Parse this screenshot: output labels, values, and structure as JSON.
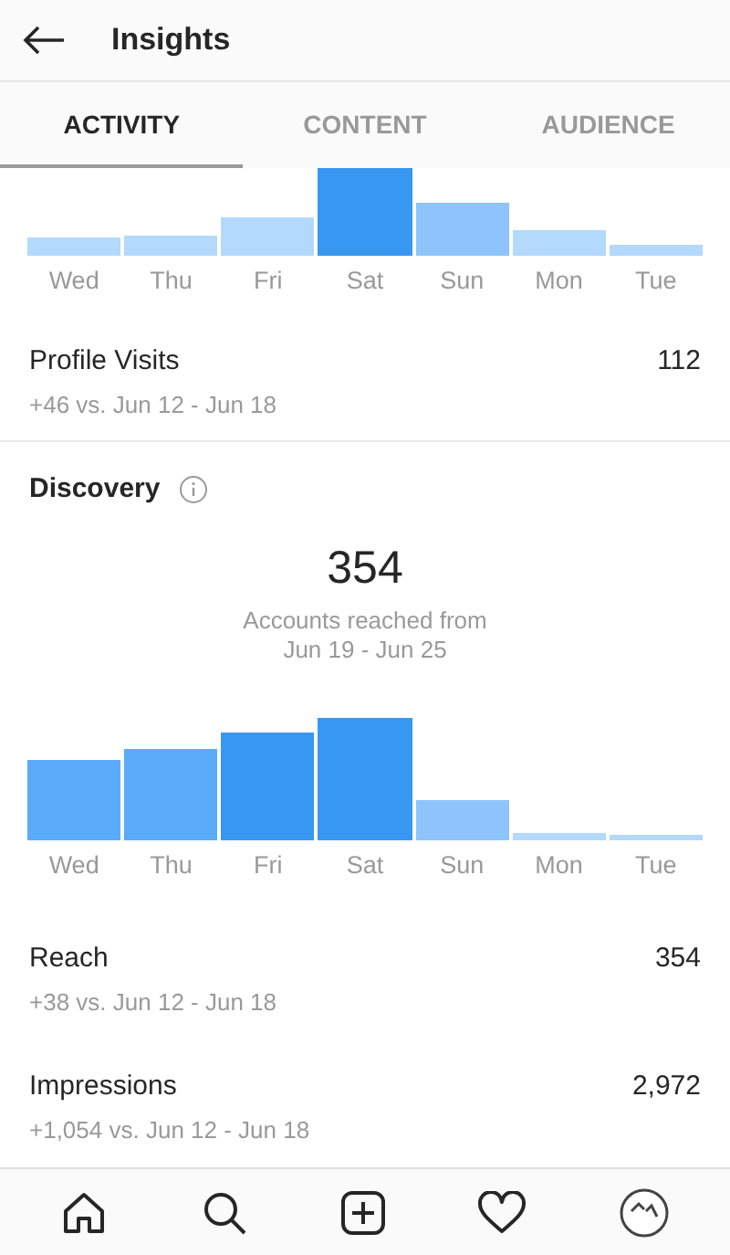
{
  "header": {
    "title": "Insights"
  },
  "tabs": [
    {
      "label": "ACTIVITY",
      "selected": true
    },
    {
      "label": "CONTENT",
      "selected": false
    },
    {
      "label": "AUDIENCE",
      "selected": false
    }
  ],
  "activity_chart": {
    "bars": [
      {
        "day": "Wed",
        "color": "#b3d9fd"
      },
      {
        "day": "Thu",
        "color": "#b3d9fd"
      },
      {
        "day": "Fri",
        "color": "#b3d9fd"
      },
      {
        "day": "Sat",
        "color": "#3897f0"
      },
      {
        "day": "Sun",
        "color": "#8dc4fb"
      },
      {
        "day": "Mon",
        "color": "#b3d9fd"
      },
      {
        "day": "Tue",
        "color": "#b3d9fd"
      }
    ]
  },
  "profile_visits": {
    "label": "Profile Visits",
    "value": "112",
    "change": "+46 vs. Jun 12 - Jun 18"
  },
  "discovery": {
    "title": "Discovery",
    "total": "354",
    "caption_line_1": "Accounts reached from",
    "caption_line_2": "Jun 19 - Jun 25",
    "chart": {
      "bars": [
        {
          "day": "Wed",
          "color": "#5aacfa"
        },
        {
          "day": "Thu",
          "color": "#5aacfa"
        },
        {
          "day": "Fri",
          "color": "#3897f0"
        },
        {
          "day": "Sat",
          "color": "#3897f0"
        },
        {
          "day": "Sun",
          "color": "#8dc4fb"
        },
        {
          "day": "Mon",
          "color": "#b3d9fd"
        },
        {
          "day": "Tue",
          "color": "#b3d9fd"
        }
      ]
    },
    "metrics": [
      {
        "label": "Reach",
        "value": "354",
        "change": "+38 vs. Jun 12 - Jun 18"
      },
      {
        "label": "Impressions",
        "value": "2,972",
        "change": "+1,054 vs. Jun 12 - Jun 18"
      }
    ]
  },
  "nav": [
    {
      "kind": "home"
    },
    {
      "kind": "search"
    },
    {
      "kind": "add"
    },
    {
      "kind": "heart"
    },
    {
      "kind": "profile"
    }
  ]
}
